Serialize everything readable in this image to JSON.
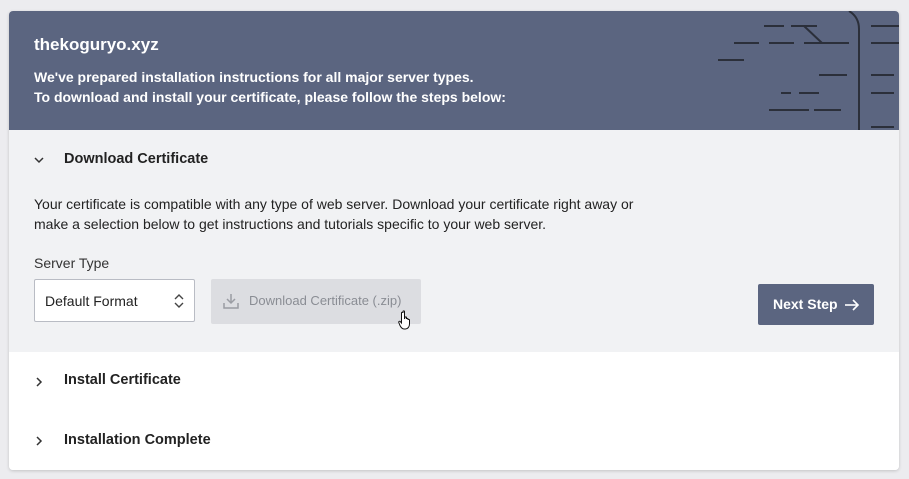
{
  "header": {
    "domain": "thekoguryo.xyz",
    "intro_line1": "We've prepared installation instructions for all major server types.",
    "intro_line2": "To download and install your certificate, please follow the steps below:"
  },
  "steps": [
    {
      "title": "Download Certificate",
      "expanded": true
    },
    {
      "title": "Install Certificate",
      "expanded": false
    },
    {
      "title": "Installation Complete",
      "expanded": false
    }
  ],
  "download_section": {
    "description": "Your certificate is compatible with any type of web server. Download your certificate right away or make a selection below to get instructions and tutorials specific to your web server.",
    "server_type_label": "Server Type",
    "server_type_selected": "Default Format",
    "download_button_label": "Download Certificate (.zip)",
    "next_button_label": "Next Step"
  },
  "colors": {
    "header_bg": "#5b6580",
    "primary_button": "#5b6580",
    "disabled_button": "#dcdde1",
    "section_bg": "#f1f2f4"
  },
  "icons": [
    "chevron-down-icon",
    "chevron-right-icon",
    "select-arrows-icon",
    "download-icon",
    "arrow-right-icon",
    "hand-cursor-icon"
  ]
}
